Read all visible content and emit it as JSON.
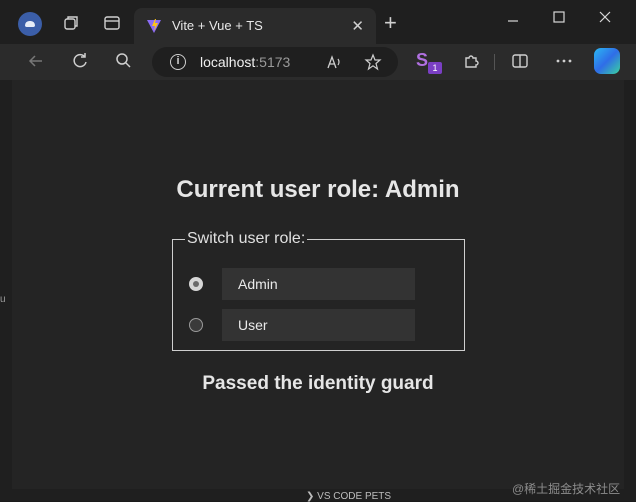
{
  "browser": {
    "tab_title": "Vite + Vue + TS",
    "tab_close": "✕",
    "new_tab": "+",
    "url_host": "localhost",
    "url_port": ":5173",
    "extension_badge": "1",
    "extension_letter": "S"
  },
  "page": {
    "title": "Current user role: Admin",
    "legend": "Switch user role:",
    "roles": [
      {
        "label": "Admin",
        "checked": true
      },
      {
        "label": "User",
        "checked": false
      }
    ],
    "guard_message": "Passed the identity guard"
  },
  "footer": {
    "vscode_label": "VS CODE PETS",
    "watermark": "@稀土掘金技术社区"
  },
  "icons": {
    "vite_logo": "vite-logo-icon"
  }
}
